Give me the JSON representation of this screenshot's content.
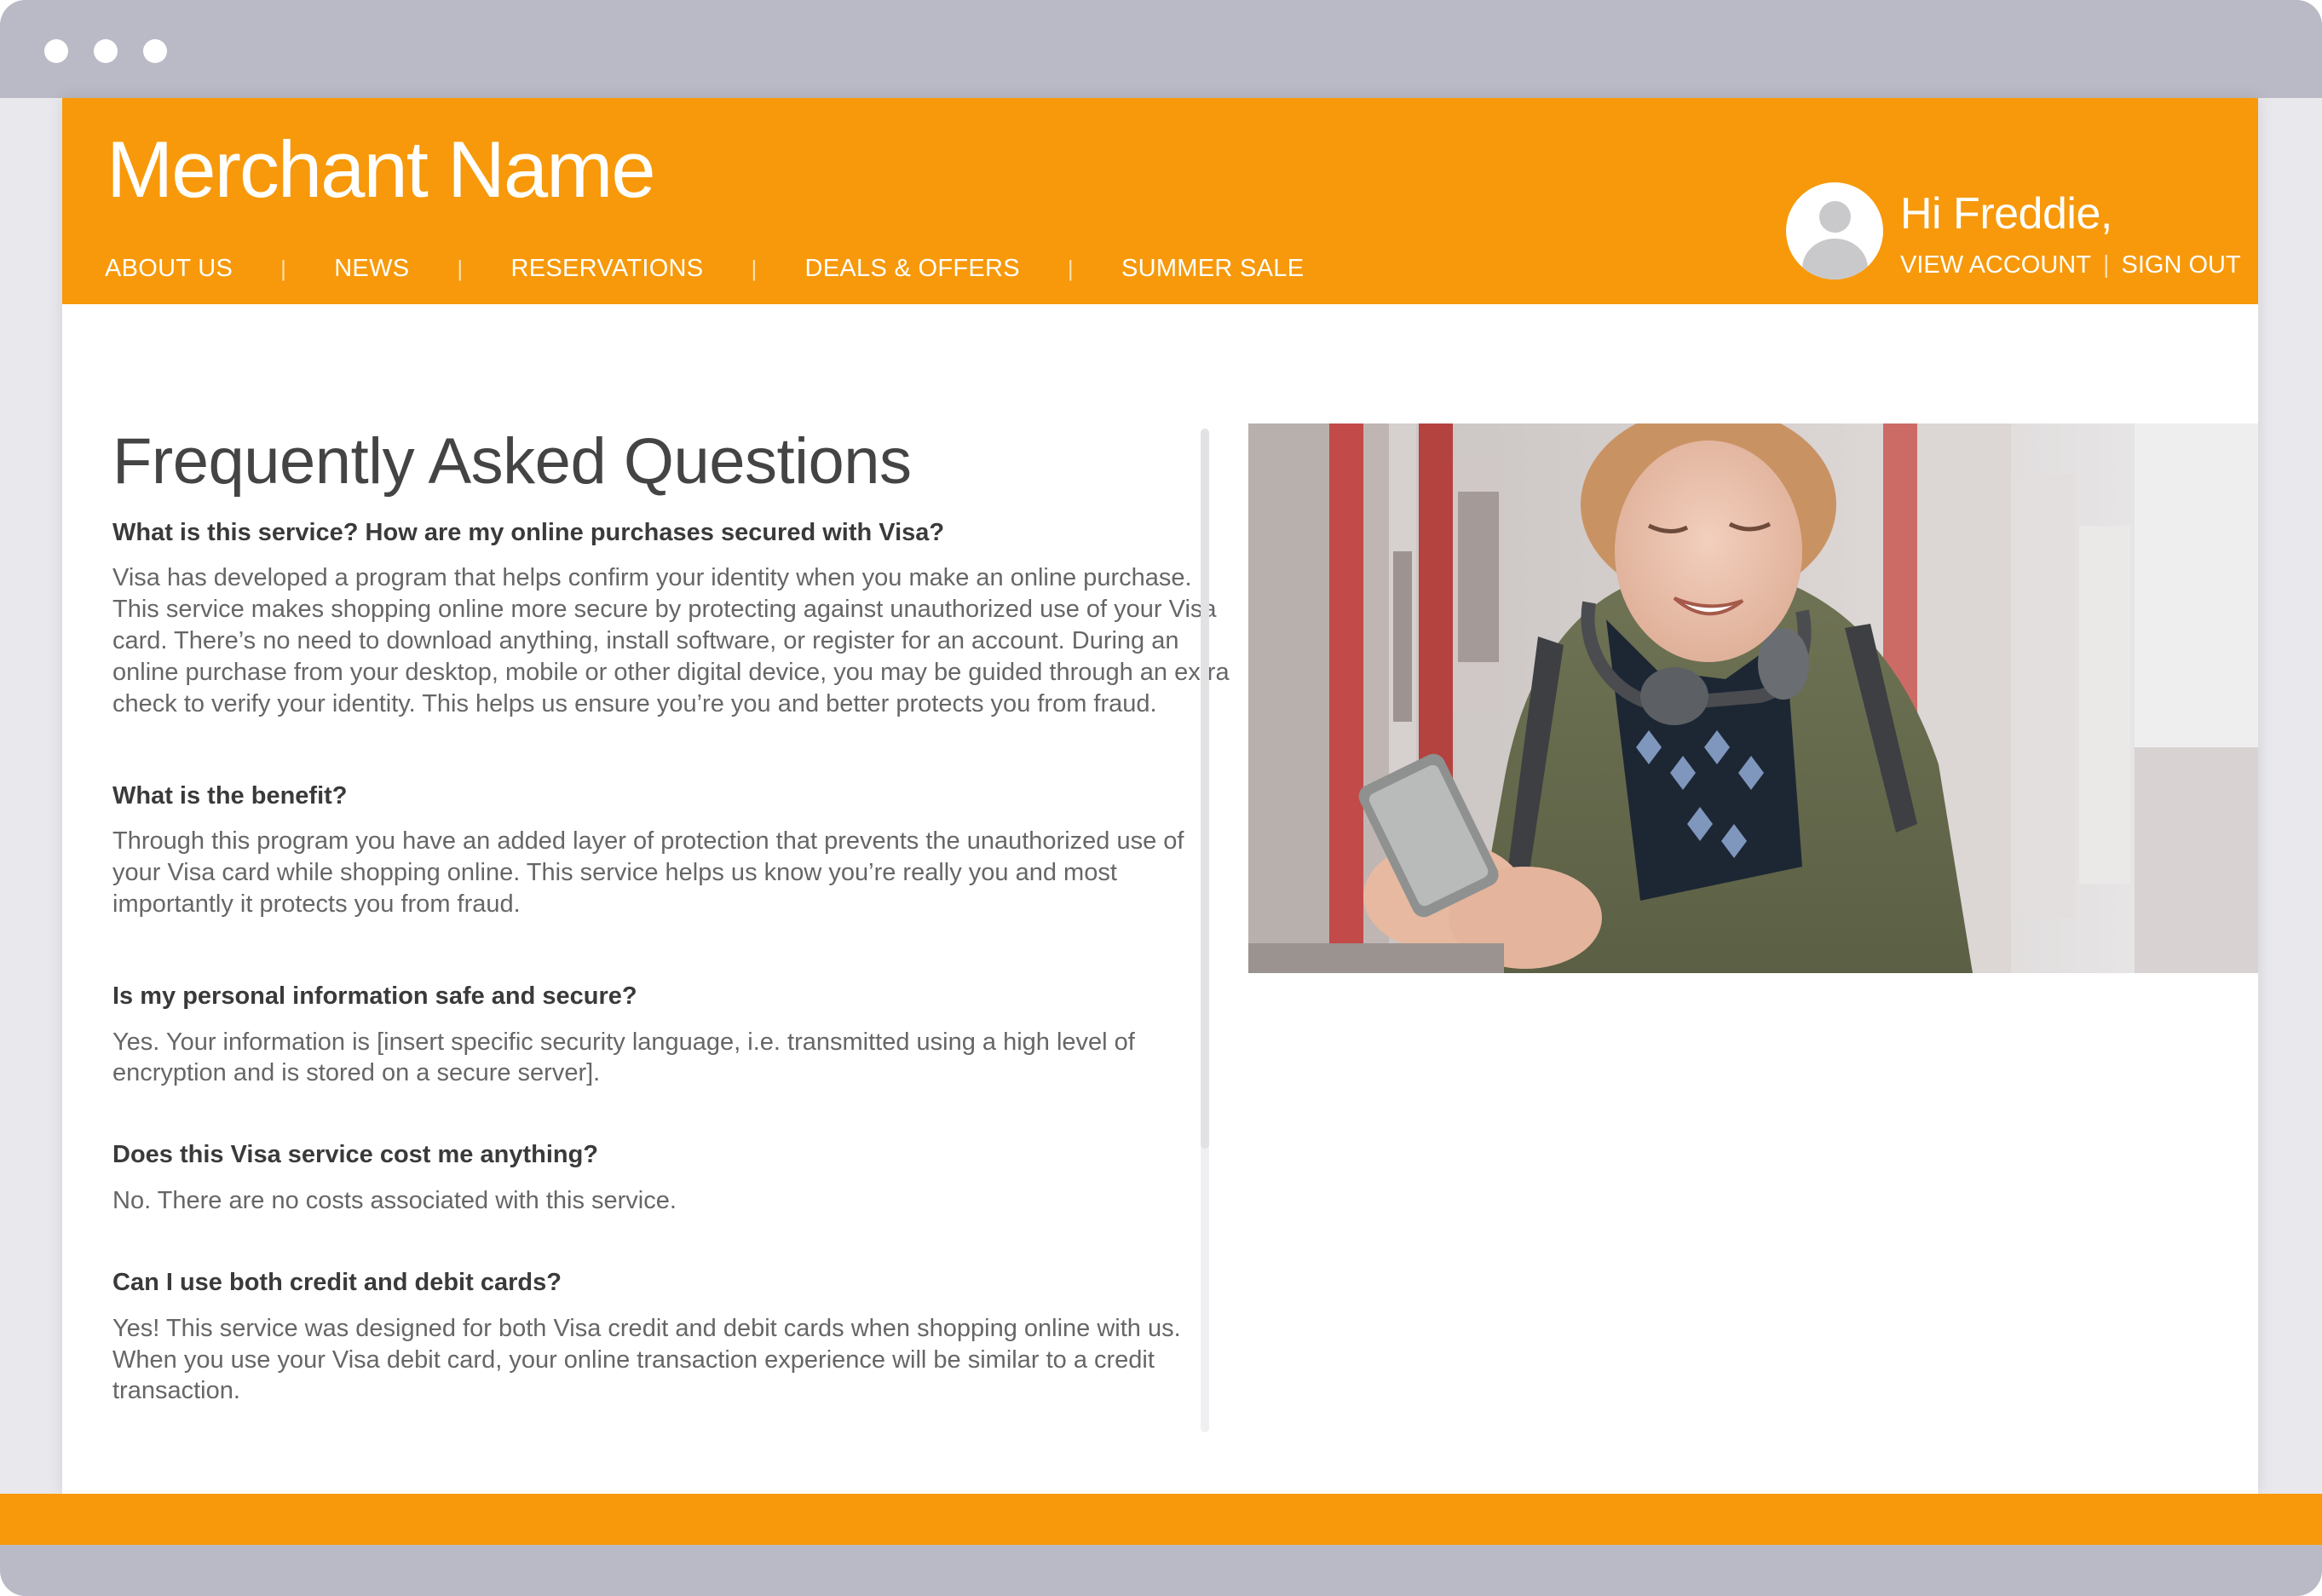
{
  "header": {
    "brand": "Merchant Name",
    "nav": [
      "ABOUT US",
      "NEWS",
      "RESERVATIONS",
      "DEALS & OFFERS",
      "SUMMER SALE"
    ],
    "nav_separator": "|",
    "greeting": "Hi Freddie,",
    "view_account": "VIEW ACCOUNT",
    "sign_out": "SIGN OUT"
  },
  "faq": {
    "title": "Frequently Asked Questions",
    "items": [
      {
        "q": "What is this service? How are my online purchases secured with Visa?",
        "a": "Visa has developed a program that helps confirm your identity when you make an online purchase.  This service makes shopping online more secure by protecting against unauthorized use of your Visa card. There’s no need to download anything, install software, or register for an account. During an online purchase from your desktop, mobile or other digital device, you may be guided through an extra check to verify your identity. This helps us ensure you’re you and better protects you from fraud."
      },
      {
        "q": "What is the benefit?",
        "a": "Through this program you have an added layer of protection that prevents the unauthorized use of your Visa card while shopping online. This service helps us know you’re really you and most importantly it protects you from fraud."
      },
      {
        "q": "Is my personal information safe and secure?",
        "a": "Yes. Your information is [insert specific security language, i.e. transmitted using a high level of encryption and is stored on a secure server]."
      },
      {
        "q": "Does this Visa service cost me anything?",
        "a": "No. There are no costs associated with this service."
      },
      {
        "q": "Can I use both credit and debit cards?",
        "a": "Yes! This service was designed for both Visa credit and debit cards when shopping online with us. When you use your Visa debit card, your online transaction experience will be similar to a credit transaction."
      }
    ]
  },
  "colors": {
    "brand_orange": "#f7990a",
    "frame_gray": "#b9bac5",
    "heading": "#444444",
    "body_text": "#666666"
  },
  "icons": {
    "avatar": "user-avatar-icon",
    "window_dots": "window-control-icon"
  }
}
